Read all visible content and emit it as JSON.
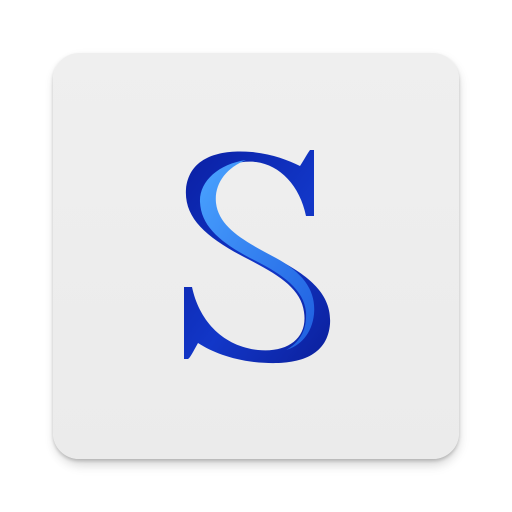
{
  "app_icon": {
    "letter": "S",
    "colors": {
      "tile": "#ececec",
      "letter_dark": "#0a1fa3",
      "letter_mid": "#1237c8",
      "letter_light": "#2f8af5"
    }
  }
}
